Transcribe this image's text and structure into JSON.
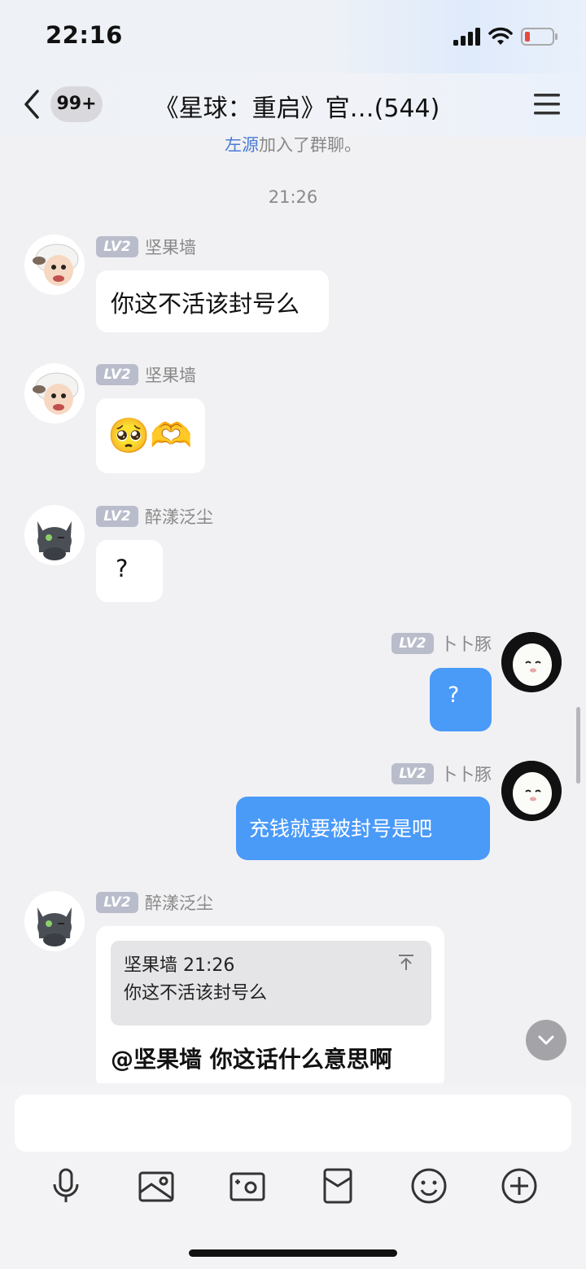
{
  "status_bar": {
    "time": "22:16",
    "icons": [
      "signal-icon",
      "wifi-icon",
      "battery-low-icon"
    ],
    "battery_color": "#e5483f"
  },
  "header": {
    "back_icon": "chevron-left-icon",
    "unread_badge": "99+",
    "title": "《星球：重启》官…(544)",
    "menu_icon": "hamburger-menu-icon"
  },
  "system_message": {
    "name": "左源",
    "text": "加入了群聊。"
  },
  "timestamp": "21:26",
  "messages": [
    {
      "sender": "坚果墙",
      "level": "LV2",
      "text": "你这不活该封号么",
      "side": "left"
    },
    {
      "sender": "坚果墙",
      "level": "LV2",
      "text": "🥺🫶",
      "side": "left",
      "type": "emoji"
    },
    {
      "sender": "醉漾泛尘",
      "level": "LV2",
      "text": "?",
      "side": "left"
    },
    {
      "sender": "卜卜豚",
      "level": "LV2",
      "text": "?",
      "side": "right"
    },
    {
      "sender": "卜卜豚",
      "level": "LV2",
      "text": "充钱就要被封号是吧",
      "side": "right"
    },
    {
      "sender": "醉漾泛尘",
      "level": "LV2",
      "side": "left",
      "quote": {
        "author_time": "坚果墙 21:26",
        "text": "你这不活该封号么"
      },
      "text": "@坚果墙 你这话什么意思啊"
    }
  ],
  "colors": {
    "my_bubble": "#4a9af8",
    "level_badge": "#b9bccb",
    "mention_link": "#4a7bd6"
  },
  "input": {
    "placeholder": ""
  },
  "toolbar": [
    "microphone-icon",
    "image-icon",
    "camera-icon",
    "red-packet-icon",
    "emoji-icon",
    "plus-icon"
  ]
}
